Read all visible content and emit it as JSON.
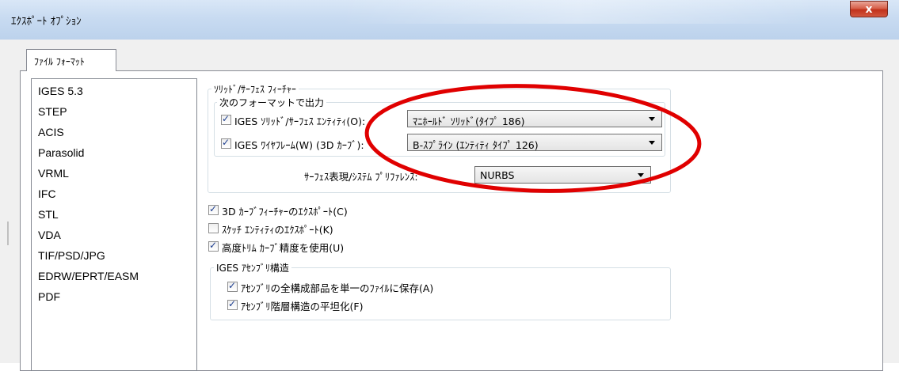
{
  "window": {
    "title": "ｴｸｽﾎﾟｰﾄ ｵﾌﾟｼｮﾝ",
    "close_label": "x"
  },
  "tabs": [
    {
      "label": "ﾌｧｲﾙ ﾌｫｰﾏｯﾄ",
      "selected": true
    }
  ],
  "formats": [
    "IGES 5.3",
    "STEP",
    "ACIS",
    "Parasolid",
    "VRML",
    "IFC",
    "STL",
    "VDA",
    "TIF/PSD/JPG",
    "EDRW/EPRT/EASM",
    "PDF"
  ],
  "selected_format": "IGES 5.3",
  "solid_surface": {
    "group_label": "ｿﾘｯﾄﾞ/ｻｰﾌｪｽ ﾌｨｰﾁｬｰ",
    "output_group_label": "次のフォーマットで出力",
    "iges_solid": {
      "label": "IGES ｿﾘｯﾄﾞ/ｻｰﾌｪｽ ｴﾝﾃｨﾃｨ(O):",
      "checked": true,
      "value": "ﾏﾆﾎｰﾙﾄﾞ ｿﾘｯﾄﾞ(ﾀｲﾌﾟ 186)"
    },
    "iges_wire": {
      "label": "IGES ﾜｲﾔﾌﾚｰﾑ(W) (3D ｶｰﾌﾞ):",
      "checked": true,
      "value": "B-ｽﾌﾟﾗｲﾝ (ｴﾝﾃｨﾃｨ ﾀｲﾌﾟ 126)"
    },
    "surface_pref": {
      "label": "ｻｰﾌｪｽ表現/ｼｽﾃﾑ ﾌﾟﾘﾌｧﾚﾝｽ:",
      "value": "NURBS"
    }
  },
  "options": [
    {
      "label": "3D ｶｰﾌﾞﾌｨｰﾁｬｰのｴｸｽﾎﾟｰﾄ(C)",
      "checked": true
    },
    {
      "label": "ｽｹｯﾁ ｴﾝﾃｨﾃｨのｴｸｽﾎﾟｰﾄ(K)",
      "checked": false
    },
    {
      "label": "高度ﾄﾘﾑ ｶｰﾌﾞ精度を使用(U)",
      "checked": true
    }
  ],
  "assembly": {
    "group_label": "IGES ｱｾﾝﾌﾞﾘ構造",
    "items": [
      {
        "label": "ｱｾﾝﾌﾞﾘの全構成部品を単一のﾌｧｲﾙに保存(A)",
        "checked": true
      },
      {
        "label": "ｱｾﾝﾌﾞﾘ階層構造の平坦化(F)",
        "checked": true
      }
    ]
  },
  "colors": {
    "annotation_ellipse": "#e00000",
    "title_gradient": "#c8dbf1",
    "close_button": "#c1321b"
  }
}
